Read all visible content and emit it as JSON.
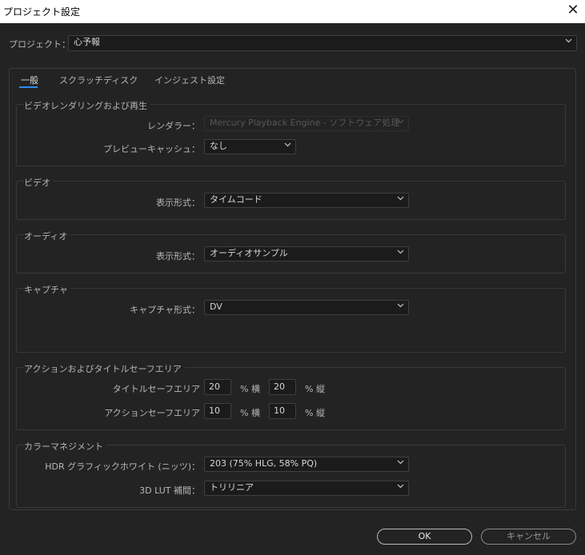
{
  "window": {
    "title": "プロジェクト設定",
    "close_glyph": "✕"
  },
  "project": {
    "label": "プロジェクト：",
    "value": "心予報"
  },
  "tabs": [
    {
      "label": "一般",
      "active": true
    },
    {
      "label": "スクラッチディスク",
      "active": false
    },
    {
      "label": "インジェスト設定",
      "active": false
    }
  ],
  "groups": {
    "video_render": {
      "title": "ビデオレンダリングおよび再生",
      "renderer_label": "レンダラー：",
      "renderer_value": "Mercury Playback Engine - ソフトウェア処理",
      "preview_cache_label": "プレビューキャッシュ：",
      "preview_cache_value": "なし"
    },
    "video": {
      "title": "ビデオ",
      "display_format_label": "表示形式：",
      "display_format_value": "タイムコード"
    },
    "audio": {
      "title": "オーディオ",
      "display_format_label": "表示形式：",
      "display_format_value": "オーディオサンプル"
    },
    "capture": {
      "title": "キャプチャ",
      "format_label": "キャプチャ形式：",
      "format_value": "DV"
    },
    "safe_area": {
      "title": "アクションおよびタイトルセーフエリア",
      "title_safe_label": "タイトルセーフエリア",
      "title_safe_h": "20",
      "title_safe_v": "20",
      "action_safe_label": "アクションセーフエリア",
      "action_safe_h": "10",
      "action_safe_v": "10",
      "unit_h": "% 横",
      "unit_v": "% 縦"
    },
    "color": {
      "title": "カラーマネジメント",
      "hdr_label": "HDR グラフィックホワイト (ニッツ)：",
      "hdr_value": "203 (75% HLG, 58% PQ)",
      "lut_label": "3D LUT 補間：",
      "lut_value": "トリリニア"
    }
  },
  "buttons": {
    "ok": "OK",
    "cancel": "キャンセル"
  }
}
